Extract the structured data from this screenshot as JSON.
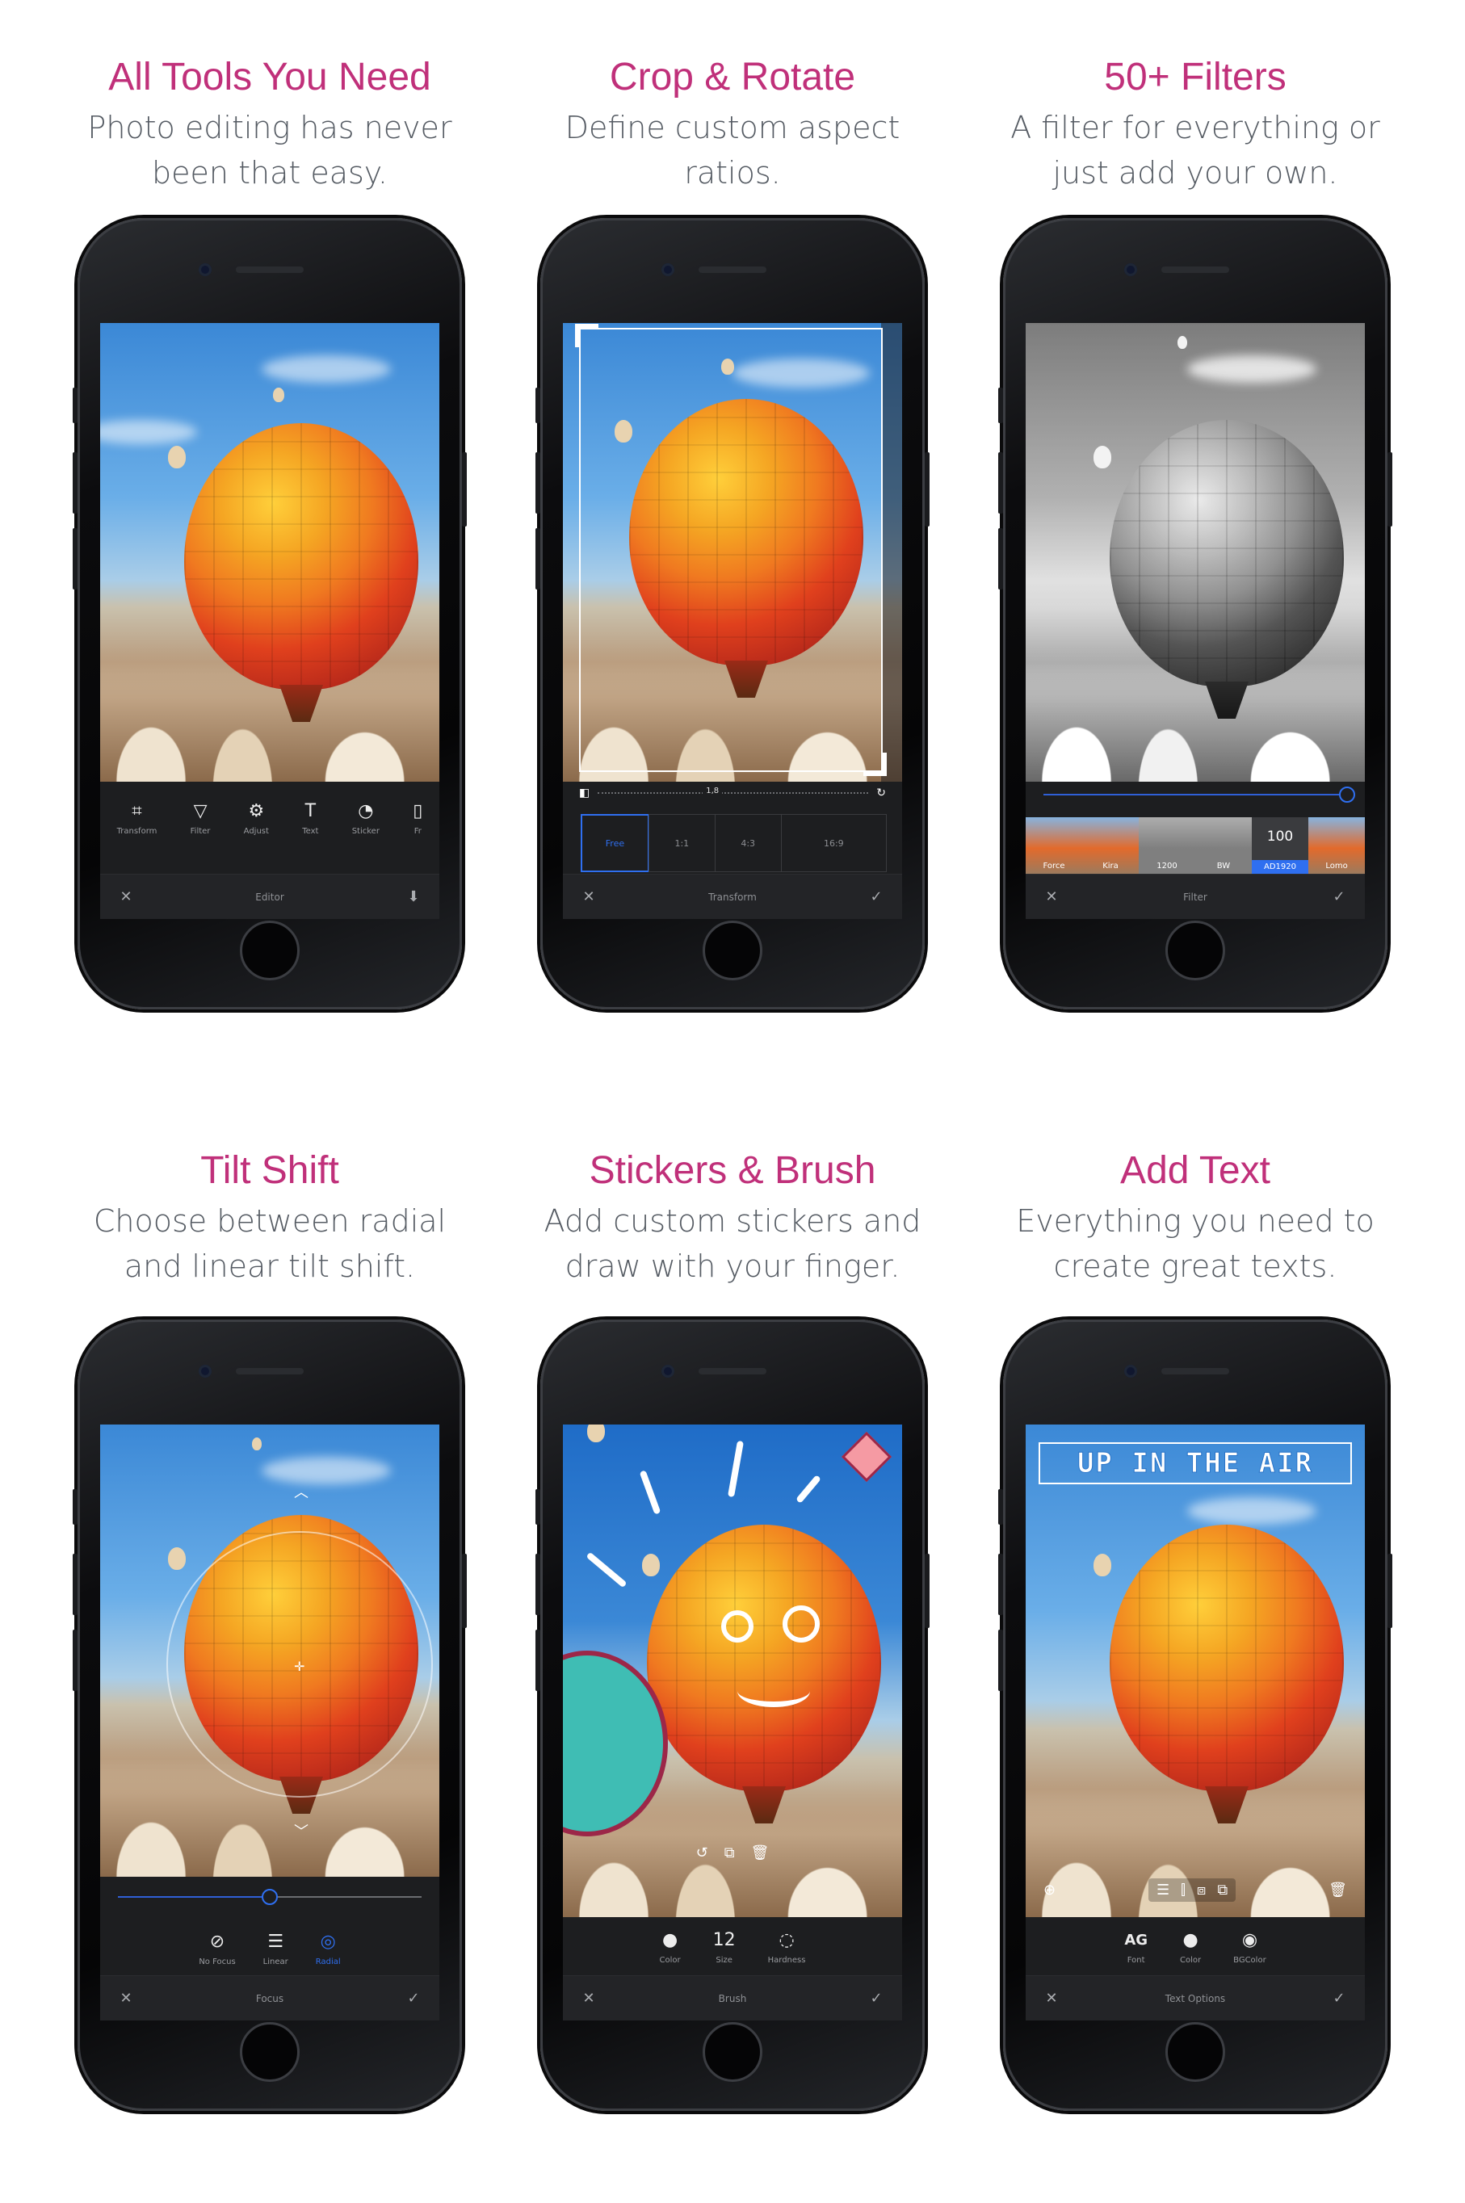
{
  "features": [
    {
      "title": "All Tools You Need",
      "desc_line1": "Photo editing has never",
      "desc_line2": "been that easy.",
      "screen": {
        "tools": [
          {
            "icon": "crop-icon",
            "glyph": "⌗",
            "label": "Transform"
          },
          {
            "icon": "filter-icon",
            "glyph": "▽",
            "label": "Filter"
          },
          {
            "icon": "adjust-icon",
            "glyph": "⚙",
            "label": "Adjust"
          },
          {
            "icon": "text-icon",
            "glyph": "T",
            "label": "Text"
          },
          {
            "icon": "sticker-icon",
            "glyph": "◔",
            "label": "Sticker"
          },
          {
            "icon": "frame-icon",
            "glyph": "▯",
            "label": "Fr"
          }
        ],
        "bar_title": "Editor",
        "close": "✕",
        "confirm": "⬇"
      }
    },
    {
      "title": "Crop & Rotate",
      "desc_line1": "Define custom aspect",
      "desc_line2": "ratios.",
      "screen": {
        "ruler_value": "1,8",
        "ratios": [
          "Free",
          "1:1",
          "4:3",
          "16:9"
        ],
        "bar_title": "Transform",
        "close": "✕",
        "confirm": "✓"
      }
    },
    {
      "title": "50+ Filters",
      "desc_line1": "A filter for everything or",
      "desc_line2": "just add your own.",
      "screen": {
        "filters": [
          "Force",
          "Kira",
          "1200",
          "BW",
          "AD1920",
          "Lomo"
        ],
        "selected_filter": "AD1920",
        "selected_value": "100",
        "intensity": 1.0,
        "bar_title": "Filter",
        "close": "✕",
        "confirm": "✓"
      }
    },
    {
      "title": "Tilt Shift",
      "desc_line1": "Choose between radial",
      "desc_line2": "and linear tilt shift.",
      "screen": {
        "modes": [
          {
            "icon": "no-focus-icon",
            "glyph": "⊘",
            "label": "No Focus"
          },
          {
            "icon": "linear-icon",
            "glyph": "☰",
            "label": "Linear"
          },
          {
            "icon": "radial-icon",
            "glyph": "◎",
            "label": "Radial"
          }
        ],
        "active_mode": "Radial",
        "blur": 0.5,
        "bar_title": "Focus",
        "close": "✕",
        "confirm": "✓"
      }
    },
    {
      "title": "Stickers & Brush",
      "desc_line1": "Add custom stickers and",
      "desc_line2": "draw with your finger.",
      "screen": {
        "options": [
          {
            "icon": "color-icon",
            "glyph": "●",
            "label": "Color"
          },
          {
            "icon": "size-icon",
            "glyph": "12",
            "label": "Size"
          },
          {
            "icon": "hardness-icon",
            "glyph": "◌",
            "label": "Hardness"
          }
        ],
        "bar_title": "Brush",
        "close": "✕",
        "confirm": "✓"
      }
    },
    {
      "title": "Add Text",
      "desc_line1": "Everything you need to",
      "desc_line2": "create great texts.",
      "screen": {
        "banner_text": "UP IN THE AIR",
        "options": [
          {
            "icon": "font-icon",
            "glyph": "AG",
            "label": "Font"
          },
          {
            "icon": "color-icon",
            "glyph": "●",
            "label": "Color"
          },
          {
            "icon": "bgcolor-icon",
            "glyph": "◉",
            "label": "BGColor"
          }
        ],
        "bar_title": "Text Options",
        "close": "✕",
        "confirm": "✓"
      }
    }
  ]
}
